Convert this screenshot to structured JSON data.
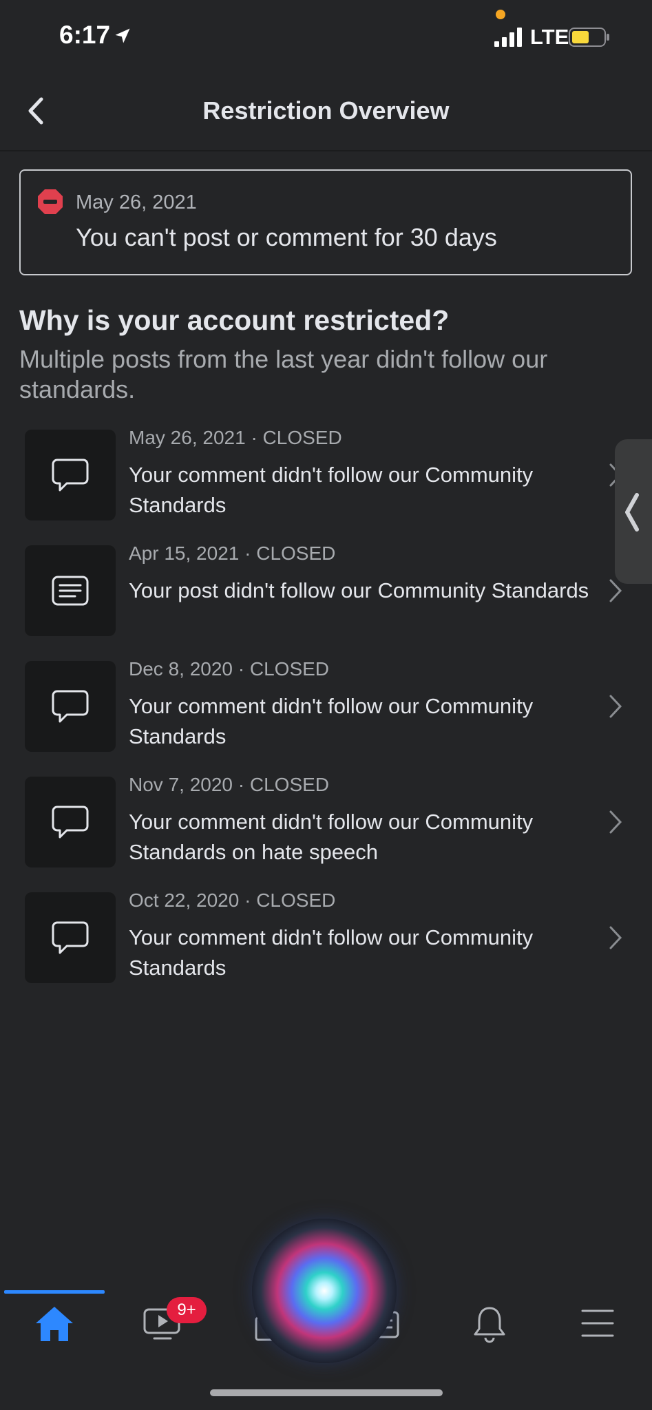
{
  "status_bar": {
    "time": "6:17",
    "network": "LTE"
  },
  "header": {
    "title": "Restriction Overview"
  },
  "restriction": {
    "date": "May 26, 2021",
    "message": "You can't post or comment for 30 days"
  },
  "why": {
    "title": "Why is your account restricted?",
    "description": "Multiple posts from the last year didn't follow our standards."
  },
  "violations": [
    {
      "icon": "comment-icon",
      "meta": "May 26, 2021 · CLOSED",
      "text": "Your comment didn't follow our Community Standards"
    },
    {
      "icon": "post-icon",
      "meta": "Apr 15, 2021 · CLOSED",
      "text": "Your post didn't follow our Community Standards"
    },
    {
      "icon": "comment-icon",
      "meta": "Dec 8, 2020 · CLOSED",
      "text": "Your comment didn't follow our Community Standards"
    },
    {
      "icon": "comment-icon",
      "meta": "Nov 7, 2020 · CLOSED",
      "text": "Your comment didn't follow our Community Standards on hate speech"
    },
    {
      "icon": "comment-icon",
      "meta": "Oct 22, 2020 · CLOSED",
      "text": "Your comment didn't follow our Community Standards"
    }
  ],
  "bottom_nav": {
    "items": [
      "home-icon",
      "video-icon",
      "marketplace-icon",
      "news-icon",
      "bell-icon",
      "menu-icon"
    ],
    "video_badge": "9+"
  },
  "colors": {
    "background": "#242527",
    "accent": "#2d88ff",
    "badge": "#e41e3f",
    "stop": "#e0404e"
  }
}
